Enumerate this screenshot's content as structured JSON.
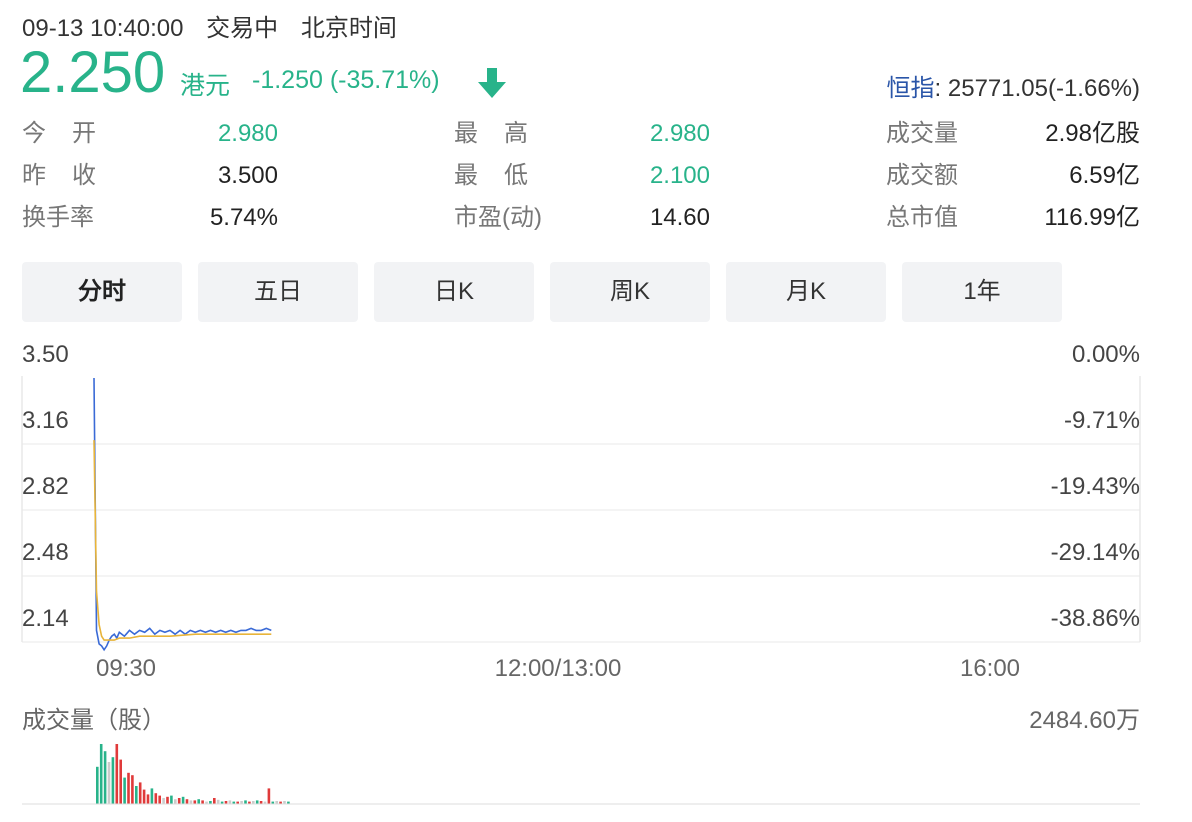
{
  "status": {
    "datetime": "09-13 10:40:00",
    "state": "交易中",
    "timezone": "北京时间"
  },
  "quote": {
    "price": "2.250",
    "currency": "港元",
    "change": "-1.250 (-35.71%)",
    "direction_icon": "arrow-down-icon",
    "up_color": "#e03a3a",
    "down_color": "#28b38a"
  },
  "index": {
    "name": "恒指",
    "value": ": 25771.05(-1.66%)"
  },
  "stats": {
    "col1": [
      {
        "label": "今开",
        "value": "2.980",
        "green": true
      },
      {
        "label": "昨收",
        "value": "3.500",
        "green": false
      },
      {
        "label": "换手率",
        "value": "5.74%",
        "green": false
      }
    ],
    "col2": [
      {
        "label": "最高",
        "value": "2.980",
        "green": true
      },
      {
        "label": "最低",
        "value": "2.100",
        "green": true
      },
      {
        "label": "市盈(动)",
        "value": "14.60",
        "green": false
      }
    ],
    "col3": [
      {
        "label": "成交量",
        "value": "2.98亿股",
        "green": false
      },
      {
        "label": "成交额",
        "value": "6.59亿",
        "green": false
      },
      {
        "label": "总市值",
        "value": "116.99亿",
        "green": false
      }
    ]
  },
  "tabs": [
    "分时",
    "五日",
    "日K",
    "周K",
    "月K",
    "1年"
  ],
  "active_tab": 0,
  "chart_data": {
    "type": "line",
    "y_ticks": [
      "3.50",
      "3.16",
      "2.82",
      "2.48",
      "2.14"
    ],
    "y_tick_values": [
      3.5,
      3.16,
      2.82,
      2.48,
      2.14
    ],
    "pct_ticks": [
      "0.00%",
      "-9.71%",
      "-19.43%",
      "-29.14%",
      "-38.86%"
    ],
    "ylim": [
      2.14,
      3.5
    ],
    "x_ticks": [
      "09:30",
      "12:00/13:00",
      "16:00"
    ],
    "x_tick_minutes": [
      0,
      150,
      330
    ],
    "x_range_minutes": [
      0,
      330
    ],
    "line_colors": [
      "#3a6ad6",
      "#e8b43a"
    ],
    "series": [
      {
        "minutes": [
          0,
          1,
          2,
          3,
          4,
          5,
          6,
          7,
          8,
          9,
          10,
          12,
          14,
          16,
          18,
          20,
          22,
          24,
          26,
          28,
          30,
          32,
          34,
          36,
          38,
          40,
          42,
          44,
          46,
          48,
          50,
          52,
          54,
          56,
          58,
          60,
          62,
          64,
          66,
          68,
          70
        ],
        "values": [
          3.5,
          2.2,
          2.13,
          2.12,
          2.1,
          2.12,
          2.15,
          2.17,
          2.18,
          2.16,
          2.19,
          2.17,
          2.2,
          2.18,
          2.2,
          2.19,
          2.21,
          2.18,
          2.2,
          2.19,
          2.2,
          2.18,
          2.2,
          2.18,
          2.2,
          2.19,
          2.2,
          2.19,
          2.2,
          2.19,
          2.2,
          2.19,
          2.2,
          2.19,
          2.2,
          2.2,
          2.21,
          2.2,
          2.2,
          2.21,
          2.2
        ]
      },
      {
        "minutes": [
          0,
          1,
          2,
          3,
          4,
          6,
          8,
          10,
          14,
          18,
          22,
          30,
          40,
          50,
          60,
          70
        ],
        "values": [
          3.18,
          2.4,
          2.23,
          2.17,
          2.15,
          2.15,
          2.15,
          2.16,
          2.16,
          2.17,
          2.17,
          2.17,
          2.18,
          2.18,
          2.18,
          2.18
        ]
      }
    ]
  },
  "volume": {
    "label": "成交量（股）",
    "max_label": "2484.60万",
    "colors": [
      "#e03a3a",
      "#28b38a",
      "#cccccc"
    ],
    "bars": [
      [
        0.62,
        1
      ],
      [
        1.0,
        1
      ],
      [
        0.88,
        1
      ],
      [
        0.7,
        2
      ],
      [
        0.78,
        1
      ],
      [
        1.0,
        0
      ],
      [
        0.74,
        0
      ],
      [
        0.44,
        1
      ],
      [
        0.52,
        0
      ],
      [
        0.48,
        0
      ],
      [
        0.3,
        1
      ],
      [
        0.36,
        0
      ],
      [
        0.24,
        0
      ],
      [
        0.16,
        0
      ],
      [
        0.26,
        1
      ],
      [
        0.18,
        0
      ],
      [
        0.14,
        0
      ],
      [
        0.1,
        2
      ],
      [
        0.12,
        0
      ],
      [
        0.14,
        1
      ],
      [
        0.08,
        2
      ],
      [
        0.1,
        0
      ],
      [
        0.12,
        1
      ],
      [
        0.08,
        0
      ],
      [
        0.06,
        2
      ],
      [
        0.06,
        0
      ],
      [
        0.08,
        1
      ],
      [
        0.06,
        0
      ],
      [
        0.04,
        2
      ],
      [
        0.05,
        1
      ],
      [
        0.1,
        0
      ],
      [
        0.07,
        2
      ],
      [
        0.04,
        1
      ],
      [
        0.05,
        0
      ],
      [
        0.06,
        2
      ],
      [
        0.04,
        1
      ],
      [
        0.04,
        0
      ],
      [
        0.05,
        2
      ],
      [
        0.06,
        1
      ],
      [
        0.04,
        0
      ],
      [
        0.05,
        2
      ],
      [
        0.06,
        1
      ],
      [
        0.05,
        0
      ],
      [
        0.04,
        2
      ],
      [
        0.26,
        0
      ],
      [
        0.04,
        1
      ],
      [
        0.05,
        2
      ],
      [
        0.04,
        0
      ],
      [
        0.05,
        2
      ],
      [
        0.04,
        1
      ]
    ]
  }
}
